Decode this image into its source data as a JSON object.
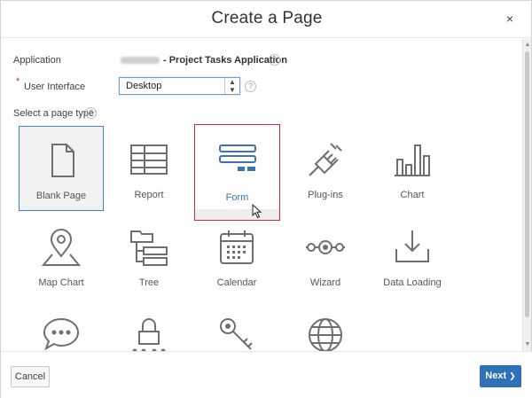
{
  "dialog": {
    "title": "Create a Page",
    "close_label": "×"
  },
  "form": {
    "application_label": "Application",
    "application_value": "- Project Tasks Application",
    "ui_label": "User Interface",
    "ui_required_marker": "*",
    "ui_value": "Desktop",
    "page_type_label": "Select a page type:",
    "help_glyph": "?"
  },
  "tiles": [
    {
      "label": "Blank Page",
      "icon": "blank-page-icon",
      "state": "selected"
    },
    {
      "label": "Report",
      "icon": "report-icon"
    },
    {
      "label": "Form",
      "icon": "form-icon",
      "state": "hover"
    },
    {
      "label": "Plug-ins",
      "icon": "plugin-icon"
    },
    {
      "label": "Chart",
      "icon": "chart-icon"
    },
    {
      "label": "Map Chart",
      "icon": "map-pin-icon"
    },
    {
      "label": "Tree",
      "icon": "tree-icon"
    },
    {
      "label": "Calendar",
      "icon": "calendar-icon"
    },
    {
      "label": "Wizard",
      "icon": "wizard-icon"
    },
    {
      "label": "Data Loading",
      "icon": "download-icon"
    },
    {
      "label": "",
      "icon": "chat-bubble-icon"
    },
    {
      "label": "",
      "icon": "lock-icon"
    },
    {
      "label": "",
      "icon": "key-icon"
    },
    {
      "label": "",
      "icon": "globe-icon"
    }
  ],
  "footer": {
    "cancel_label": "Cancel",
    "next_label": "Next",
    "next_glyph": "❯"
  },
  "colors": {
    "accent": "#2f71b8",
    "icon": "#6f6f6f",
    "form_icon": "#3b73b5",
    "highlight": "#d62b2b",
    "required": "#c0392b"
  }
}
